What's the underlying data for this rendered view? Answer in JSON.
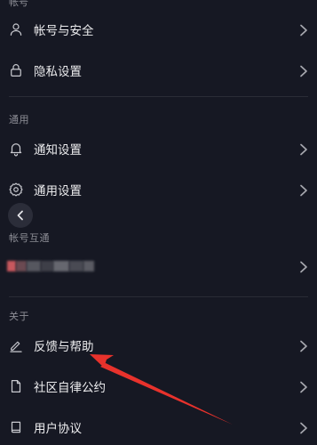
{
  "sections": {
    "account_header": "帐号",
    "general_header": "通用",
    "interop_header": "帐号互通",
    "about_header": "关于"
  },
  "items": {
    "account_security": "帐号与安全",
    "privacy_settings": "隐私设置",
    "notification_settings": "通知设置",
    "general_settings": "通用设置",
    "feedback_help": "反馈与帮助",
    "community_rules": "社区自律公约",
    "user_agreement": "用户协议"
  },
  "icons": {
    "account_security": "user-icon",
    "privacy_settings": "lock-icon",
    "notification_settings": "bell-icon",
    "general_settings": "gear-icon",
    "feedback_help": "pen-icon",
    "community_rules": "document-icon",
    "user_agreement": "book-icon",
    "back": "chevron-left-icon",
    "row_arrow": "chevron-right-icon"
  },
  "colors": {
    "background": "#161823",
    "annotation_arrow": "#e8322c"
  }
}
